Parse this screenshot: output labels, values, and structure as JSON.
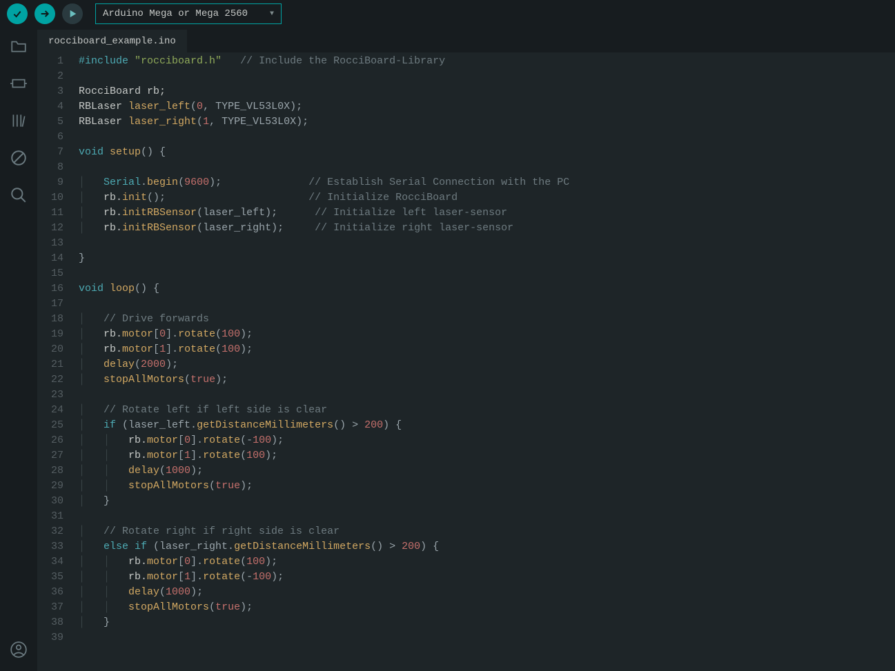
{
  "toolbar": {
    "board": "Arduino Mega or Mega 2560"
  },
  "tab": {
    "name": "rocciboard_example.ino"
  },
  "code": {
    "line_start": 1,
    "lines": [
      [
        {
          "t": "#include ",
          "c": "kw"
        },
        {
          "t": "\"rocciboard.h\"",
          "c": "str"
        },
        {
          "t": "   "
        },
        {
          "t": "// Include the RocciBoard-Library",
          "c": "comm"
        }
      ],
      [],
      [
        {
          "t": "RocciBoard rb;",
          "c": "ident"
        }
      ],
      [
        {
          "t": "RBLaser ",
          "c": "ident"
        },
        {
          "t": "laser_left",
          "c": "fn"
        },
        {
          "t": "(",
          "c": "paren"
        },
        {
          "t": "0",
          "c": "num"
        },
        {
          "t": ", TYPE_VL53L0X);",
          "c": "paren"
        }
      ],
      [
        {
          "t": "RBLaser ",
          "c": "ident"
        },
        {
          "t": "laser_right",
          "c": "fn"
        },
        {
          "t": "(",
          "c": "paren"
        },
        {
          "t": "1",
          "c": "num"
        },
        {
          "t": ", TYPE_VL53L0X);",
          "c": "paren"
        }
      ],
      [],
      [
        {
          "t": "void ",
          "c": "type"
        },
        {
          "t": "setup",
          "c": "fn"
        },
        {
          "t": "() {",
          "c": "paren"
        }
      ],
      [],
      [
        {
          "t": "│   ",
          "c": "indent-guide"
        },
        {
          "t": "Serial",
          "c": "kw"
        },
        {
          "t": ".",
          "c": "op"
        },
        {
          "t": "begin",
          "c": "fn"
        },
        {
          "t": "(",
          "c": "paren"
        },
        {
          "t": "9600",
          "c": "num"
        },
        {
          "t": ");",
          "c": "paren"
        },
        {
          "t": "              "
        },
        {
          "t": "// Establish Serial Connection with the PC",
          "c": "comm"
        }
      ],
      [
        {
          "t": "│   ",
          "c": "indent-guide"
        },
        {
          "t": "rb.",
          "c": "ident"
        },
        {
          "t": "init",
          "c": "fn"
        },
        {
          "t": "();",
          "c": "paren"
        },
        {
          "t": "                       "
        },
        {
          "t": "// Initialize RocciBoard",
          "c": "comm"
        }
      ],
      [
        {
          "t": "│   ",
          "c": "indent-guide"
        },
        {
          "t": "rb.",
          "c": "ident"
        },
        {
          "t": "initRBSensor",
          "c": "fn"
        },
        {
          "t": "(laser_left);",
          "c": "paren"
        },
        {
          "t": "      "
        },
        {
          "t": "// Initialize left laser-sensor",
          "c": "comm"
        }
      ],
      [
        {
          "t": "│   ",
          "c": "indent-guide"
        },
        {
          "t": "rb.",
          "c": "ident"
        },
        {
          "t": "initRBSensor",
          "c": "fn"
        },
        {
          "t": "(laser_right);",
          "c": "paren"
        },
        {
          "t": "     "
        },
        {
          "t": "// Initialize right laser-sensor",
          "c": "comm"
        }
      ],
      [],
      [
        {
          "t": "}",
          "c": "paren"
        }
      ],
      [],
      [
        {
          "t": "void ",
          "c": "type"
        },
        {
          "t": "loop",
          "c": "fn"
        },
        {
          "t": "() {",
          "c": "paren"
        }
      ],
      [],
      [
        {
          "t": "│   ",
          "c": "indent-guide"
        },
        {
          "t": "// Drive forwards",
          "c": "comm"
        }
      ],
      [
        {
          "t": "│   ",
          "c": "indent-guide"
        },
        {
          "t": "rb.",
          "c": "ident"
        },
        {
          "t": "motor",
          "c": "fn"
        },
        {
          "t": "[",
          "c": "paren"
        },
        {
          "t": "0",
          "c": "num"
        },
        {
          "t": "].",
          "c": "paren"
        },
        {
          "t": "rotate",
          "c": "fn"
        },
        {
          "t": "(",
          "c": "paren"
        },
        {
          "t": "100",
          "c": "num"
        },
        {
          "t": ");",
          "c": "paren"
        }
      ],
      [
        {
          "t": "│   ",
          "c": "indent-guide"
        },
        {
          "t": "rb.",
          "c": "ident"
        },
        {
          "t": "motor",
          "c": "fn"
        },
        {
          "t": "[",
          "c": "paren"
        },
        {
          "t": "1",
          "c": "num"
        },
        {
          "t": "].",
          "c": "paren"
        },
        {
          "t": "rotate",
          "c": "fn"
        },
        {
          "t": "(",
          "c": "paren"
        },
        {
          "t": "100",
          "c": "num"
        },
        {
          "t": ");",
          "c": "paren"
        }
      ],
      [
        {
          "t": "│   ",
          "c": "indent-guide"
        },
        {
          "t": "delay",
          "c": "fn"
        },
        {
          "t": "(",
          "c": "paren"
        },
        {
          "t": "2000",
          "c": "num"
        },
        {
          "t": ");",
          "c": "paren"
        }
      ],
      [
        {
          "t": "│   ",
          "c": "indent-guide"
        },
        {
          "t": "stopAllMotors",
          "c": "fn"
        },
        {
          "t": "(",
          "c": "paren"
        },
        {
          "t": "true",
          "c": "num"
        },
        {
          "t": ");",
          "c": "paren"
        }
      ],
      [],
      [
        {
          "t": "│   ",
          "c": "indent-guide"
        },
        {
          "t": "// Rotate left if left side is clear",
          "c": "comm"
        }
      ],
      [
        {
          "t": "│   ",
          "c": "indent-guide"
        },
        {
          "t": "if ",
          "c": "kw"
        },
        {
          "t": "(laser_left.",
          "c": "paren"
        },
        {
          "t": "getDistanceMillimeters",
          "c": "fn"
        },
        {
          "t": "() > ",
          "c": "paren"
        },
        {
          "t": "200",
          "c": "num"
        },
        {
          "t": ") {",
          "c": "paren"
        }
      ],
      [
        {
          "t": "│   │   ",
          "c": "indent-guide"
        },
        {
          "t": "rb.",
          "c": "ident"
        },
        {
          "t": "motor",
          "c": "fn"
        },
        {
          "t": "[",
          "c": "paren"
        },
        {
          "t": "0",
          "c": "num"
        },
        {
          "t": "].",
          "c": "paren"
        },
        {
          "t": "rotate",
          "c": "fn"
        },
        {
          "t": "(-",
          "c": "paren"
        },
        {
          "t": "100",
          "c": "num"
        },
        {
          "t": ");",
          "c": "paren"
        }
      ],
      [
        {
          "t": "│   │   ",
          "c": "indent-guide"
        },
        {
          "t": "rb.",
          "c": "ident"
        },
        {
          "t": "motor",
          "c": "fn"
        },
        {
          "t": "[",
          "c": "paren"
        },
        {
          "t": "1",
          "c": "num"
        },
        {
          "t": "].",
          "c": "paren"
        },
        {
          "t": "rotate",
          "c": "fn"
        },
        {
          "t": "(",
          "c": "paren"
        },
        {
          "t": "100",
          "c": "num"
        },
        {
          "t": ");",
          "c": "paren"
        }
      ],
      [
        {
          "t": "│   │   ",
          "c": "indent-guide"
        },
        {
          "t": "delay",
          "c": "fn"
        },
        {
          "t": "(",
          "c": "paren"
        },
        {
          "t": "1000",
          "c": "num"
        },
        {
          "t": ");",
          "c": "paren"
        }
      ],
      [
        {
          "t": "│   │   ",
          "c": "indent-guide"
        },
        {
          "t": "stopAllMotors",
          "c": "fn"
        },
        {
          "t": "(",
          "c": "paren"
        },
        {
          "t": "true",
          "c": "num"
        },
        {
          "t": ");",
          "c": "paren"
        }
      ],
      [
        {
          "t": "│   ",
          "c": "indent-guide"
        },
        {
          "t": "}",
          "c": "paren"
        }
      ],
      [],
      [
        {
          "t": "│   ",
          "c": "indent-guide"
        },
        {
          "t": "// Rotate right if right side is clear",
          "c": "comm"
        }
      ],
      [
        {
          "t": "│   ",
          "c": "indent-guide"
        },
        {
          "t": "else if ",
          "c": "kw"
        },
        {
          "t": "(laser_right.",
          "c": "paren"
        },
        {
          "t": "getDistanceMillimeters",
          "c": "fn"
        },
        {
          "t": "() > ",
          "c": "paren"
        },
        {
          "t": "200",
          "c": "num"
        },
        {
          "t": ") {",
          "c": "paren"
        }
      ],
      [
        {
          "t": "│   │   ",
          "c": "indent-guide"
        },
        {
          "t": "rb.",
          "c": "ident"
        },
        {
          "t": "motor",
          "c": "fn"
        },
        {
          "t": "[",
          "c": "paren"
        },
        {
          "t": "0",
          "c": "num"
        },
        {
          "t": "].",
          "c": "paren"
        },
        {
          "t": "rotate",
          "c": "fn"
        },
        {
          "t": "(",
          "c": "paren"
        },
        {
          "t": "100",
          "c": "num"
        },
        {
          "t": ");",
          "c": "paren"
        }
      ],
      [
        {
          "t": "│   │   ",
          "c": "indent-guide"
        },
        {
          "t": "rb.",
          "c": "ident"
        },
        {
          "t": "motor",
          "c": "fn"
        },
        {
          "t": "[",
          "c": "paren"
        },
        {
          "t": "1",
          "c": "num"
        },
        {
          "t": "].",
          "c": "paren"
        },
        {
          "t": "rotate",
          "c": "fn"
        },
        {
          "t": "(-",
          "c": "paren"
        },
        {
          "t": "100",
          "c": "num"
        },
        {
          "t": ");",
          "c": "paren"
        }
      ],
      [
        {
          "t": "│   │   ",
          "c": "indent-guide"
        },
        {
          "t": "delay",
          "c": "fn"
        },
        {
          "t": "(",
          "c": "paren"
        },
        {
          "t": "1000",
          "c": "num"
        },
        {
          "t": ");",
          "c": "paren"
        }
      ],
      [
        {
          "t": "│   │   ",
          "c": "indent-guide"
        },
        {
          "t": "stopAllMotors",
          "c": "fn"
        },
        {
          "t": "(",
          "c": "paren"
        },
        {
          "t": "true",
          "c": "num"
        },
        {
          "t": ");",
          "c": "paren"
        }
      ],
      [
        {
          "t": "│   ",
          "c": "indent-guide"
        },
        {
          "t": "}",
          "c": "paren"
        }
      ],
      []
    ]
  }
}
